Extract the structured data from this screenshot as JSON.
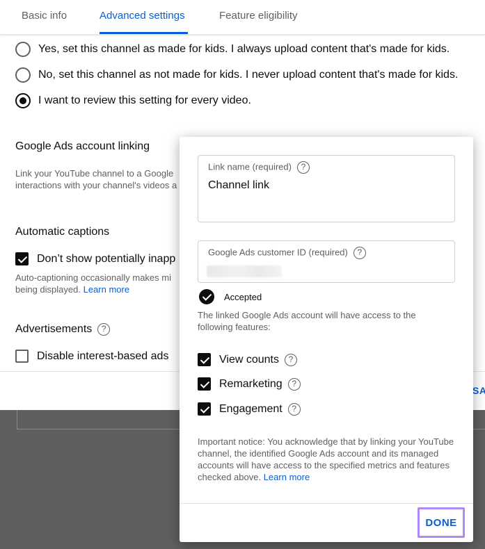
{
  "tabs": [
    {
      "label": "Basic info"
    },
    {
      "label": "Advanced settings"
    },
    {
      "label": "Feature eligibility"
    }
  ],
  "audience": {
    "options": [
      {
        "label": "Yes, set this channel as made for kids. I always upload content that's made for kids.",
        "selected": false
      },
      {
        "label": "No, set this channel as not made for kids. I never upload content that's made for kids.",
        "selected": false
      },
      {
        "label": "I want to review this setting for every video.",
        "selected": true
      }
    ]
  },
  "ads_linking": {
    "title": "Google Ads account linking",
    "desc_line1": "Link your YouTube channel to a Google",
    "desc_line2": "interactions with your channel's videos a"
  },
  "captions": {
    "title": "Automatic captions",
    "checkbox_label": "Don’t show potentially inapp",
    "checked": true,
    "desc_line1": "Auto-captioning occasionally makes mi",
    "desc_line2": "being displayed.",
    "learn_more": "Learn more"
  },
  "advertisements": {
    "title": "Advertisements",
    "help_icon": "?",
    "checkbox_label": "Disable interest-based ads",
    "checked": false
  },
  "save_label": "SA",
  "dialog": {
    "link_name": {
      "label": "Link name (required)",
      "value": "Channel link",
      "help_icon": "?"
    },
    "customer_id": {
      "label": "Google Ads customer ID (required)",
      "help_icon": "?"
    },
    "accepted": "Accepted",
    "features_intro": "The linked Google Ads account will have access to the following features:",
    "features": [
      {
        "label": "View counts",
        "checked": true,
        "help_icon": "?"
      },
      {
        "label": "Remarketing",
        "checked": true,
        "help_icon": "?"
      },
      {
        "label": "Engagement",
        "checked": true,
        "help_icon": "?"
      }
    ],
    "notice": "Important notice: You acknowledge that by linking your YouTube channel, the identified Google Ads account and its managed accounts will have access to the specified metrics and features checked above.",
    "learn_more": "Learn more",
    "done": "DONE"
  },
  "colors": {
    "accent": "#065fd4",
    "done_highlight": "#b189f5",
    "overlay": "#5f5f5f"
  }
}
